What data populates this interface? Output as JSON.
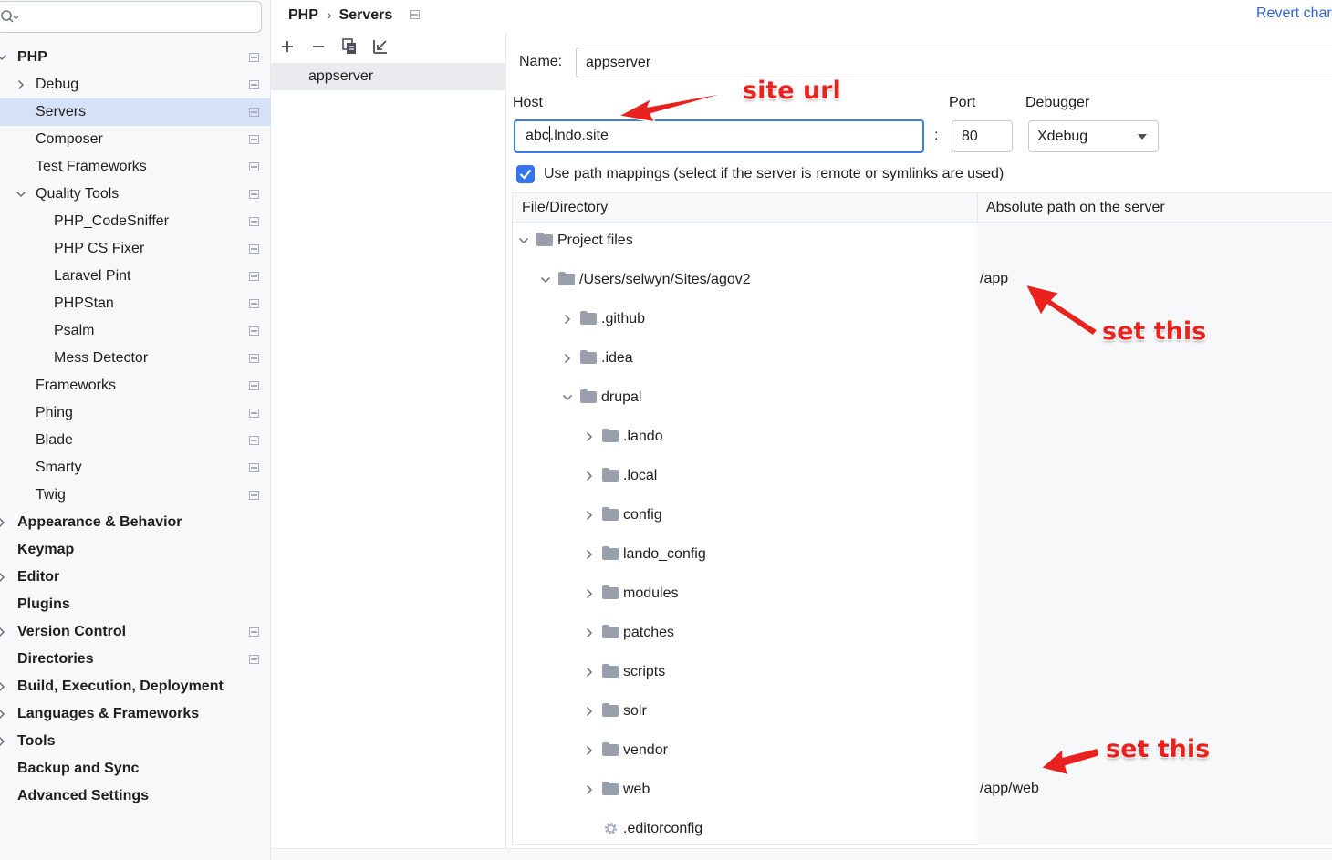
{
  "breadcrumb": {
    "parent": "PHP",
    "separator": "›",
    "current": "Servers"
  },
  "revert_link": "Revert char",
  "search": {
    "value": ""
  },
  "sidebar": {
    "items": [
      {
        "label": "PHP",
        "bold": true,
        "expanded": true,
        "has_page_icon": true
      },
      {
        "label": "Debug",
        "collapsed": true,
        "has_page_icon": true
      },
      {
        "label": "Servers",
        "selected": true,
        "has_page_icon": true
      },
      {
        "label": "Composer",
        "has_page_icon": true
      },
      {
        "label": "Test Frameworks",
        "has_page_icon": true
      },
      {
        "label": "Quality Tools",
        "expanded": true,
        "has_page_icon": true
      },
      {
        "label": "PHP_CodeSniffer",
        "has_page_icon": true
      },
      {
        "label": "PHP CS Fixer",
        "has_page_icon": true
      },
      {
        "label": "Laravel Pint",
        "has_page_icon": true
      },
      {
        "label": "PHPStan",
        "has_page_icon": true
      },
      {
        "label": "Psalm",
        "has_page_icon": true
      },
      {
        "label": "Mess Detector",
        "has_page_icon": true
      },
      {
        "label": "Frameworks",
        "has_page_icon": true
      },
      {
        "label": "Phing",
        "has_page_icon": true
      },
      {
        "label": "Blade",
        "has_page_icon": true
      },
      {
        "label": "Smarty",
        "has_page_icon": true
      },
      {
        "label": "Twig",
        "has_page_icon": true
      },
      {
        "label": "Appearance & Behavior",
        "bold": true,
        "collapsed": true
      },
      {
        "label": "Keymap",
        "bold": true
      },
      {
        "label": "Editor",
        "bold": true,
        "collapsed": true
      },
      {
        "label": "Plugins",
        "bold": true
      },
      {
        "label": "Version Control",
        "bold": true,
        "collapsed": true,
        "has_page_icon": true
      },
      {
        "label": "Directories",
        "bold": true,
        "has_page_icon": true
      },
      {
        "label": "Build, Execution, Deployment",
        "bold": true,
        "collapsed": true
      },
      {
        "label": "Languages & Frameworks",
        "bold": true,
        "collapsed": true
      },
      {
        "label": "Tools",
        "bold": true,
        "collapsed": true
      },
      {
        "label": "Backup and Sync",
        "bold": true
      },
      {
        "label": "Advanced Settings",
        "bold": true
      }
    ]
  },
  "toolbar": {
    "icons": [
      "add-icon",
      "remove-icon",
      "copy-icon",
      "import-icon"
    ]
  },
  "servers": [
    {
      "name": "appserver",
      "selected": true
    }
  ],
  "form": {
    "name_label": "Name:",
    "name_value": "appserver",
    "host_label": "Host",
    "host_before_caret": "abc",
    "host_after_caret": ".lndo.site",
    "port_separator": ":",
    "port_label": "Port",
    "port_value": "80",
    "debugger_label": "Debugger",
    "debugger_value": "Xdebug",
    "use_path_mappings_label": "Use path mappings (select if the server is remote or symlinks are used)",
    "use_path_mappings_checked": true
  },
  "mappings": {
    "columns": [
      "File/Directory",
      "Absolute path on the server"
    ],
    "rows": [
      {
        "name": "Project files",
        "icon": "folder-icon",
        "toggle": "expanded",
        "server_path": ""
      },
      {
        "name": "/Users/selwyn/Sites/agov2",
        "icon": "folder-icon",
        "toggle": "expanded",
        "server_path": "/app"
      },
      {
        "name": ".github",
        "icon": "folder-icon",
        "toggle": "collapsed",
        "server_path": ""
      },
      {
        "name": ".idea",
        "icon": "folder-icon",
        "toggle": "collapsed",
        "server_path": ""
      },
      {
        "name": "drupal",
        "icon": "folder-icon",
        "toggle": "expanded",
        "server_path": ""
      },
      {
        "name": ".lando",
        "icon": "folder-icon",
        "toggle": "collapsed",
        "server_path": ""
      },
      {
        "name": ".local",
        "icon": "folder-icon",
        "toggle": "collapsed",
        "server_path": ""
      },
      {
        "name": "config",
        "icon": "folder-icon",
        "toggle": "collapsed",
        "server_path": ""
      },
      {
        "name": "lando_config",
        "icon": "folder-icon",
        "toggle": "collapsed",
        "server_path": ""
      },
      {
        "name": "modules",
        "icon": "folder-icon",
        "toggle": "collapsed",
        "server_path": ""
      },
      {
        "name": "patches",
        "icon": "folder-icon",
        "toggle": "collapsed",
        "server_path": ""
      },
      {
        "name": "scripts",
        "icon": "folder-icon",
        "toggle": "collapsed",
        "server_path": ""
      },
      {
        "name": "solr",
        "icon": "folder-icon",
        "toggle": "collapsed",
        "server_path": ""
      },
      {
        "name": "vendor",
        "icon": "folder-icon",
        "toggle": "collapsed",
        "server_path": ""
      },
      {
        "name": "web",
        "icon": "folder-icon",
        "toggle": "collapsed",
        "server_path": "/app/web"
      },
      {
        "name": ".editorconfig",
        "icon": "gear-icon",
        "toggle": "none",
        "server_path": ""
      }
    ]
  },
  "annotations": {
    "host_note": "site url",
    "path_note_1": "set this",
    "path_note_2": "set this",
    "color": "#e8231f"
  }
}
